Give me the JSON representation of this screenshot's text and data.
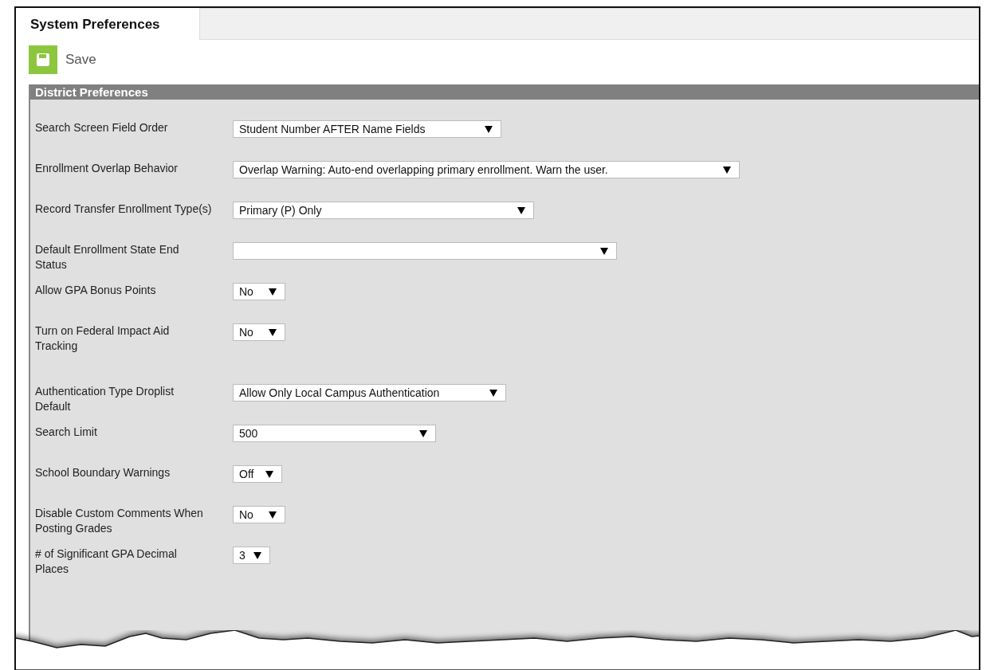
{
  "tab": {
    "label": "System Preferences",
    "selected": true
  },
  "save_button": {
    "label": "Save"
  },
  "panel": {
    "title": "District Preferences",
    "rows": [
      {
        "label": "Search Screen Field Order",
        "value": "Student Number AFTER Name Fields"
      },
      {
        "label": "Enrollment Overlap Behavior",
        "value": "Overlap Warning: Auto-end overlapping primary enrollment. Warn the user."
      },
      {
        "label": "Record Transfer Enrollment Type(s)",
        "value": "Primary (P) Only"
      },
      {
        "label": "Default Enrollment State End Status",
        "value": ""
      },
      {
        "label": "Allow GPA Bonus Points",
        "value": "No"
      },
      {
        "label": "Turn on Federal Impact Aid Tracking",
        "value": "No"
      },
      {
        "label": "Authentication Type Droplist Default",
        "value": "Allow Only Local Campus Authentication"
      },
      {
        "label": "Search Limit",
        "value": "500"
      },
      {
        "label": "School Boundary Warnings",
        "value": "Off"
      },
      {
        "label": "Disable Custom Comments When Posting Grades",
        "value": "No"
      },
      {
        "label": "# of Significant GPA Decimal Places",
        "value": "3"
      }
    ]
  }
}
